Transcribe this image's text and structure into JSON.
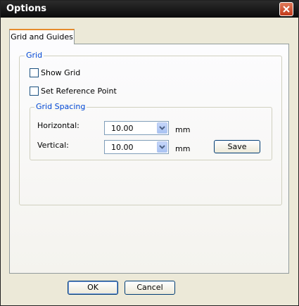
{
  "window": {
    "title": "Options"
  },
  "tabs": [
    {
      "label": "Grid and Guides",
      "selected": true
    }
  ],
  "grid_group": {
    "label": "Grid",
    "show_grid": {
      "label": "Show Grid",
      "checked": false
    },
    "set_reference_point": {
      "label": "Set Reference Point",
      "checked": false
    }
  },
  "spacing_group": {
    "label": "Grid Spacing",
    "horizontal": {
      "label": "Horizontal:",
      "value": "10.00",
      "unit": "mm"
    },
    "vertical": {
      "label": "Vertical:",
      "value": "10.00",
      "unit": "mm"
    },
    "save_label": "Save"
  },
  "footer": {
    "ok_label": "OK",
    "cancel_label": "Cancel"
  },
  "colors": {
    "accent_tab": "#e68b2c",
    "group_label": "#0046d5",
    "close_button": "#c23a1a"
  }
}
